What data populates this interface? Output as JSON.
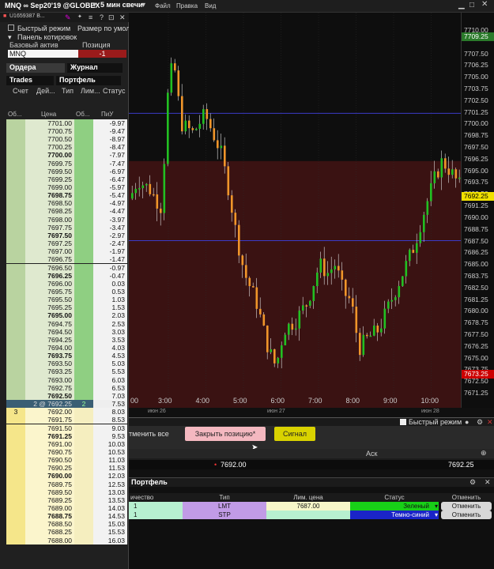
{
  "topbar": {
    "symbol": "MNQ ∞ Sep20'19 @GLOBEX",
    "interval": "5 мин свечи",
    "menu": [
      "Файл",
      "Правка",
      "Вид"
    ]
  },
  "subbar": {
    "account": "U1659387 B..."
  },
  "panel": {
    "fast_mode": "Быстрый режим",
    "size_label": "Размер по умол",
    "quotes_panel": "Панель котировок",
    "underlying_label": "Базовый актив",
    "position_label": "Позиция",
    "underlying": "MNQ",
    "position": "-1",
    "tab_orders": "Ордера",
    "tab_journal": "Журнал",
    "tab_trades": "Trades",
    "tab_portfolio": "Портфель",
    "col_account": "Счет",
    "col_action": "Дей...",
    "col_type": "Тип",
    "col_limit": "Лим...",
    "col_status": "Статус",
    "ladder_h_vol": "Об...",
    "ladder_h_price": "Цена",
    "ladder_h_vol2": "Об...",
    "ladder_h_pnl": "ПиУ"
  },
  "ladder": [
    {
      "p": "7701.00",
      "v": "-9.97"
    },
    {
      "p": "7700.75",
      "v": "-9.47"
    },
    {
      "p": "7700.50",
      "v": "-8.97"
    },
    {
      "p": "7700.25",
      "v": "-8.47"
    },
    {
      "p": "7700.00",
      "v": "-7.97",
      "b": true
    },
    {
      "p": "7699.75",
      "v": "-7.47"
    },
    {
      "p": "7699.50",
      "v": "-6.97"
    },
    {
      "p": "7699.25",
      "v": "-6.47"
    },
    {
      "p": "7699.00",
      "v": "-5.97"
    },
    {
      "p": "7698.75",
      "v": "-5.47",
      "b": true
    },
    {
      "p": "7698.50",
      "v": "-4.97"
    },
    {
      "p": "7698.25",
      "v": "-4.47"
    },
    {
      "p": "7698.00",
      "v": "-3.97"
    },
    {
      "p": "7697.75",
      "v": "-3.47"
    },
    {
      "p": "7697.50",
      "v": "-2.97",
      "b": true
    },
    {
      "p": "7697.25",
      "v": "-2.47"
    },
    {
      "p": "7697.00",
      "v": "-1.97"
    },
    {
      "p": "7696.75",
      "v": "-1.47"
    },
    {
      "p": "7696.50",
      "v": "-0.97"
    },
    {
      "p": "7696.25",
      "v": "-0.47",
      "b": true
    },
    {
      "p": "7696.00",
      "v": "0.03"
    },
    {
      "p": "7695.75",
      "v": "0.53"
    },
    {
      "p": "7695.50",
      "v": "1.03"
    },
    {
      "p": "7695.25",
      "v": "1.53"
    },
    {
      "p": "7695.00",
      "v": "2.03",
      "b": true
    },
    {
      "p": "7694.75",
      "v": "2.53"
    },
    {
      "p": "7694.50",
      "v": "3.03"
    },
    {
      "p": "7694.25",
      "v": "3.53"
    },
    {
      "p": "7694.00",
      "v": "4.03"
    },
    {
      "p": "7693.75",
      "v": "4.53",
      "b": true
    },
    {
      "p": "7693.50",
      "v": "5.03"
    },
    {
      "p": "7693.25",
      "v": "5.53"
    },
    {
      "p": "7693.00",
      "v": "6.03"
    },
    {
      "p": "7692.75",
      "v": "6.53"
    },
    {
      "p": "7692.50",
      "v": "7.03",
      "b": true
    },
    {
      "p": "2 @ 7692.25",
      "v": "7.53",
      "cur": true,
      "bid": "2"
    },
    {
      "p": "7692.00",
      "v": "8.03",
      "ask": true,
      "askv": "3"
    },
    {
      "p": "7691.75",
      "v": "8.53",
      "ask": true
    },
    {
      "p": "7691.50",
      "v": "9.03",
      "ask": true
    },
    {
      "p": "7691.25",
      "v": "9.53",
      "ask": true,
      "b": true
    },
    {
      "p": "7691.00",
      "v": "10.03",
      "ask": true
    },
    {
      "p": "7690.75",
      "v": "10.53",
      "ask": true
    },
    {
      "p": "7690.50",
      "v": "11.03",
      "ask": true
    },
    {
      "p": "7690.25",
      "v": "11.53",
      "ask": true
    },
    {
      "p": "7690.00",
      "v": "12.03",
      "ask": true,
      "b": true
    },
    {
      "p": "7689.75",
      "v": "12.53",
      "ask": true
    },
    {
      "p": "7689.50",
      "v": "13.03",
      "ask": true
    },
    {
      "p": "7689.25",
      "v": "13.53",
      "ask": true
    },
    {
      "p": "7689.00",
      "v": "14.03",
      "ask": true
    },
    {
      "p": "7688.75",
      "v": "14.53",
      "ask": true,
      "b": true
    },
    {
      "p": "7688.50",
      "v": "15.03",
      "ask": true
    },
    {
      "p": "7688.25",
      "v": "15.53",
      "ask": true
    },
    {
      "p": "7688.00",
      "v": "16.03",
      "ask": true
    }
  ],
  "chart_data": {
    "type": "candlestick",
    "ylim": [
      7671.5,
      7710.75
    ],
    "ticks": [
      "7710.00",
      "7707.50",
      "7706.25",
      "7705.00",
      "7703.75",
      "7702.50",
      "7701.25",
      "7700.00",
      "7698.75",
      "7697.50",
      "7696.25",
      "7695.00",
      "7693.75",
      "7692.50",
      "7691.25",
      "7690.00",
      "7688.75",
      "7687.50",
      "7686.25",
      "7685.00",
      "7683.75",
      "7682.50",
      "7681.25",
      "7680.00",
      "7678.75",
      "7677.50",
      "7676.25",
      "7675.00",
      "7673.75",
      "7672.50",
      "7671.25"
    ],
    "tick_values": [
      7710,
      7707.5,
      7706.25,
      7705,
      7703.75,
      7702.5,
      7701.25,
      7700,
      7698.75,
      7697.5,
      7696.25,
      7695,
      7693.75,
      7692.5,
      7691.25,
      7690,
      7688.75,
      7687.5,
      7686.25,
      7685,
      7683.75,
      7682.5,
      7681.25,
      7680,
      7678.75,
      7677.5,
      7676.25,
      7675,
      7673.75,
      7672.5,
      7671.25
    ],
    "price_tags": [
      {
        "label": "7709.25",
        "v": 7709.25,
        "color": "#2a7a2a"
      },
      {
        "label": "7692.25",
        "v": 7692.25,
        "color": "#f0e000"
      },
      {
        "label": "7673.25",
        "v": 7673.25,
        "color": "#cc0000"
      }
    ],
    "hlines": [
      7701.1,
      7687.5
    ],
    "zone": [
      7696.0,
      7671.5
    ],
    "x_labels": [
      "3:00",
      "4:00",
      "5:00",
      "6:00",
      "7:00",
      "8:00",
      "9:00",
      "10:00"
    ],
    "x_sub": [
      "июн 26",
      "июн 27",
      "июн 28"
    ],
    "first_x_label": "00"
  },
  "buttons": {
    "cancel_all": "тменить все",
    "close_position": "Закрыть позицию*",
    "signal": "Сигнал",
    "fast_mode": "Быстрый режим"
  },
  "pricebar": {
    "bid": "7692.00",
    "ask_label": "Аск",
    "ask": "7692.25"
  },
  "portfolio": {
    "tab": "Портфель",
    "h_qty": "ичество",
    "h_type": "Тип",
    "h_limit": "Лим. цена",
    "h_status": "Статус",
    "h_cancel": "Отменить",
    "rows": [
      {
        "qty": "1",
        "type": "LMT",
        "limit": "7687.00",
        "status": "Зеленый",
        "cancel": "Отменить"
      },
      {
        "qty": "1",
        "type": "STP",
        "limit": "",
        "status": "Темно-синий",
        "cancel": "Отменить"
      }
    ]
  },
  "colors": {
    "up": "#22c022",
    "down": "#f0952a",
    "zone": "#3a1212"
  }
}
